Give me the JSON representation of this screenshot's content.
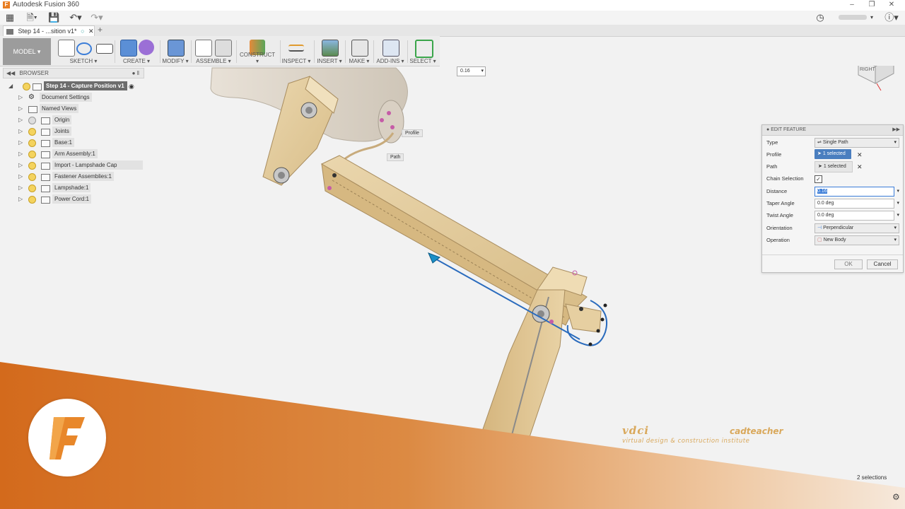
{
  "app": {
    "title": "Autodesk Fusion 360",
    "logo_letter": "F"
  },
  "document_tab": {
    "label": "Step 14 - ...sition v1*"
  },
  "ribbon": {
    "workspace": "MODEL",
    "groups": [
      "SKETCH",
      "CREATE",
      "MODIFY",
      "ASSEMBLE",
      "CONSTRUCT",
      "INSPECT",
      "INSERT",
      "MAKE",
      "ADD-INS",
      "SELECT"
    ]
  },
  "browser": {
    "title": "BROWSER",
    "root": "Step 14 - Capture Position v1",
    "items": [
      "Document Settings",
      "Named Views",
      "Origin",
      "Joints",
      "Base:1",
      "Arm Assembly:1",
      "Import - Lampshade Cap Assembly...",
      "Fastener Assemblies:1",
      "Lampshade:1",
      "Power Cord:1"
    ]
  },
  "canvas": {
    "distance_input": "0.16",
    "profile_tag": "Profile",
    "path_tag": "Path",
    "viewcube_face": "RIGHT"
  },
  "edit_feature": {
    "title": "EDIT FEATURE",
    "type_label": "Type",
    "type_value": "Single Path",
    "profile_label": "Profile",
    "profile_value": "1 selected",
    "path_label": "Path",
    "path_value": "1 selected",
    "chain_label": "Chain Selection",
    "distance_label": "Distance",
    "distance_value": "0.16",
    "taper_label": "Taper Angle",
    "taper_value": "0.0 deg",
    "twist_label": "Twist Angle",
    "twist_value": "0.0 deg",
    "orientation_label": "Orientation",
    "orientation_value": "Perpendicular",
    "operation_label": "Operation",
    "operation_value": "New Body",
    "ok_label": "OK",
    "cancel_label": "Cancel"
  },
  "status": {
    "selections": "2 selections"
  },
  "watermark": {
    "brand1": "vdci",
    "brand2": "cadteacher",
    "tagline": "virtual design & construction institute"
  },
  "colors": {
    "accent_orange": "#d36a1c",
    "selection_blue": "#2a6bbd",
    "wood": "#e2c99a"
  }
}
